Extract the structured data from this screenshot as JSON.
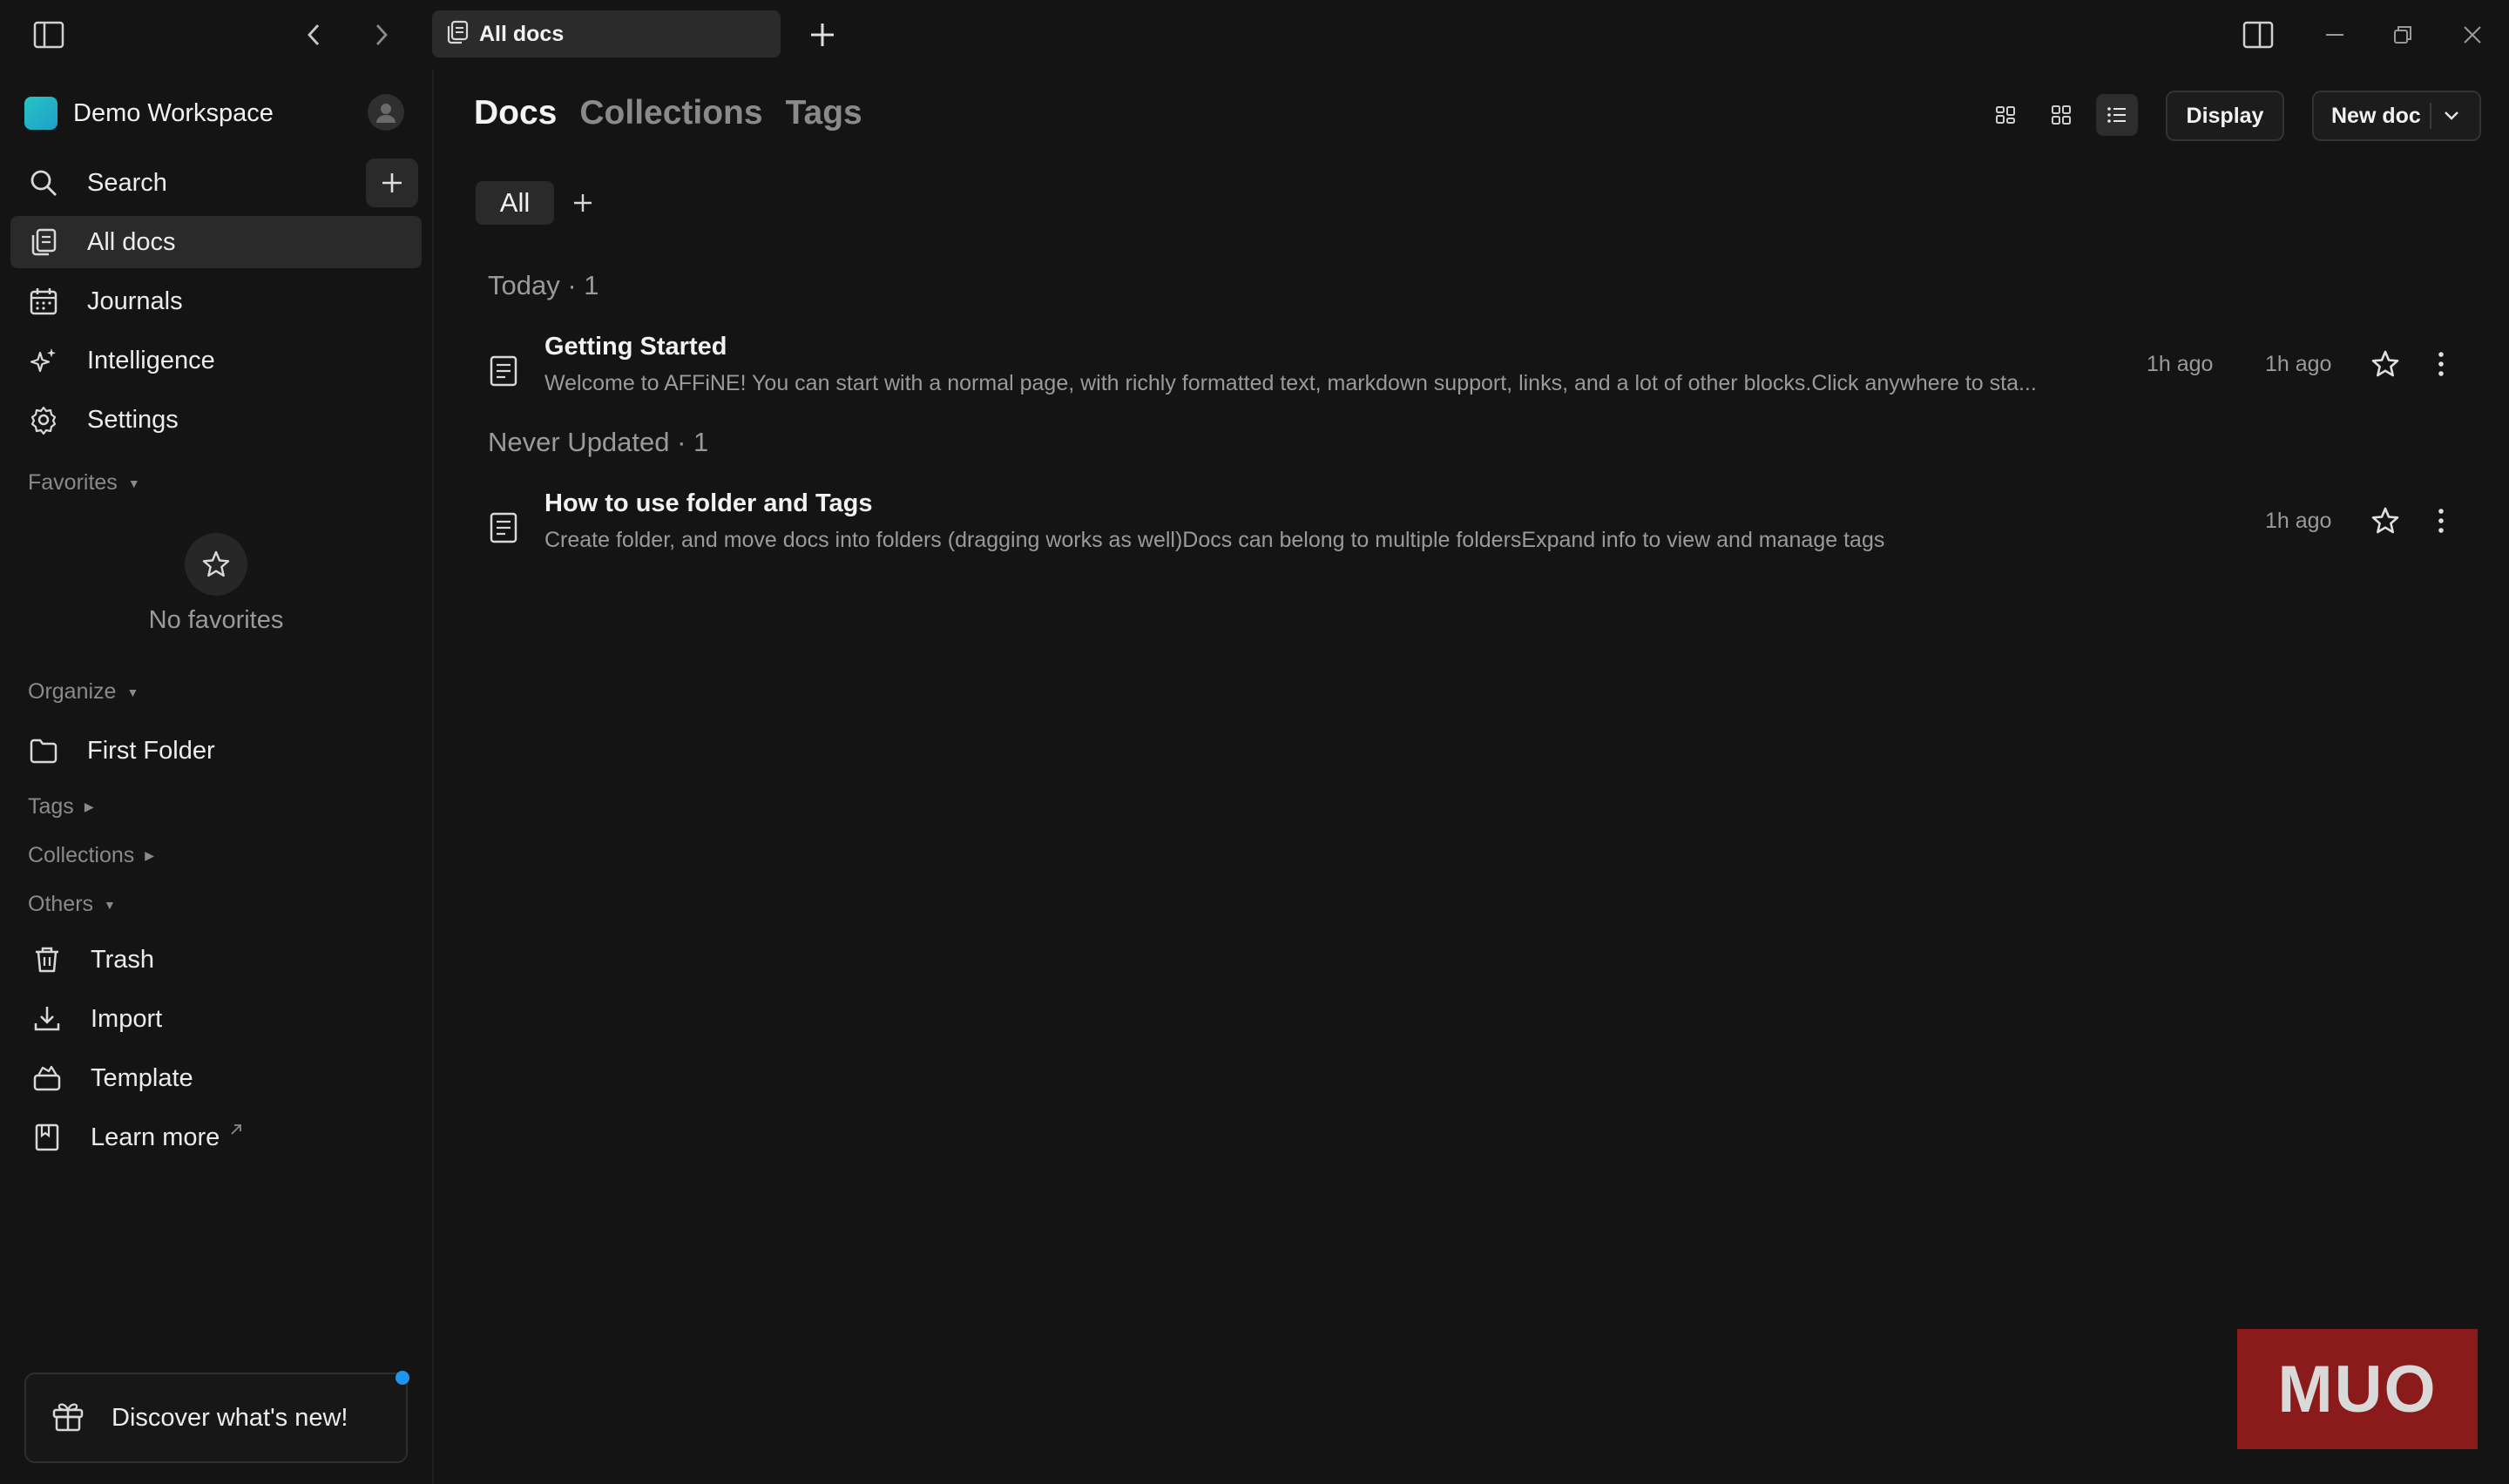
{
  "topbar": {
    "tab_label": "All docs"
  },
  "sidebar": {
    "workspace_name": "Demo Workspace",
    "nav": [
      {
        "label": "Search",
        "icon": "search-icon"
      },
      {
        "label": "All docs",
        "icon": "docs-icon"
      },
      {
        "label": "Journals",
        "icon": "calendar-icon"
      },
      {
        "label": "Intelligence",
        "icon": "sparkle-icon"
      },
      {
        "label": "Settings",
        "icon": "gear-icon"
      }
    ],
    "favorites_label": "Favorites",
    "no_favorites": "No favorites",
    "organize_label": "Organize",
    "folder_label": "First Folder",
    "tags_label": "Tags",
    "collections_label": "Collections",
    "others_label": "Others",
    "others_items": [
      {
        "label": "Trash",
        "icon": "trash-icon"
      },
      {
        "label": "Import",
        "icon": "import-icon"
      },
      {
        "label": "Template",
        "icon": "template-icon"
      },
      {
        "label": "Learn more",
        "icon": "book-icon"
      }
    ],
    "discover_label": "Discover what's new!"
  },
  "main": {
    "tabs": [
      "Docs",
      "Collections",
      "Tags"
    ],
    "display_label": "Display",
    "new_doc_label": "New doc",
    "filter_all": "All",
    "groups": [
      {
        "heading": "Today · 1",
        "docs": [
          {
            "title": "Getting Started",
            "preview": "Welcome to AFFiNE! You can start with a normal page, with richly formatted text, markdown support, links, and a lot of other blocks.Click anywhere to sta...",
            "created": "1h ago",
            "updated": "1h ago"
          }
        ]
      },
      {
        "heading": "Never Updated · 1",
        "docs": [
          {
            "title": "How to use folder and Tags",
            "preview": "Create folder, and move docs into folders (dragging works as well)Docs can belong to multiple foldersExpand info to view and manage tags",
            "created": "1h ago"
          }
        ]
      }
    ]
  },
  "watermark": "MUO",
  "colors": {
    "background": "#141414",
    "active_item": "#2a2a2a",
    "notification_dot": "#1e96eb",
    "workspace_logo": "#27c4c4"
  }
}
